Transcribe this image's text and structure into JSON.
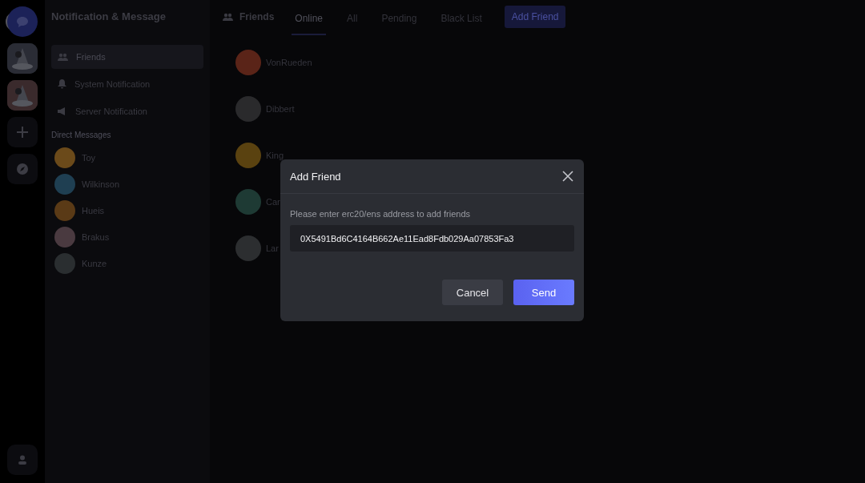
{
  "rail": {
    "items": [
      {
        "kind": "home",
        "selected": true
      },
      {
        "kind": "server",
        "color": "#2a2c35",
        "selected": false
      },
      {
        "kind": "server",
        "color": "#3a2a2c",
        "selected": false
      },
      {
        "kind": "add",
        "selected": false
      },
      {
        "kind": "explore",
        "selected": false
      }
    ]
  },
  "sidebar": {
    "title": "Notification & Message",
    "items": [
      {
        "label": "Friends",
        "selected": true
      },
      {
        "label": "System Notification",
        "selected": false
      },
      {
        "label": "Server Notification",
        "selected": false
      }
    ],
    "section_title": "Direct Messages",
    "direct_messages": [
      {
        "name": "Toy",
        "color": "#6b4a1a"
      },
      {
        "name": "Wilkinson",
        "color": "#1f3f52"
      },
      {
        "name": "Hueis",
        "color": "#5a3a16"
      },
      {
        "name": "Brakus",
        "color": "#4a3a40"
      },
      {
        "name": "Kunze",
        "color": "#2a2e30"
      }
    ]
  },
  "header": {
    "title": "Friends",
    "tabs": [
      {
        "label": "Online",
        "selected": true
      },
      {
        "label": "All",
        "selected": false
      },
      {
        "label": "Pending",
        "selected": false
      },
      {
        "label": "Black List",
        "selected": false
      }
    ],
    "add_button": "Add Friend"
  },
  "friends": [
    {
      "name": "VonRueden",
      "color": "#5a2418"
    },
    {
      "name": "Dibbert",
      "color": "#2a2a2c"
    },
    {
      "name": "King",
      "color": "#5a4210"
    },
    {
      "name": "Car",
      "color": "#1e3a34"
    },
    {
      "name": "Lar",
      "color": "#2c2e30"
    }
  ],
  "dialog": {
    "title": "Add Friend",
    "prompt": "Please enter erc20/ens address to add friends",
    "value": "0X5491Bd6C4164B662Ae11Ead8Fdb029Aa07853Fa3",
    "buttons": [
      {
        "label": "Cancel",
        "kind": "secondary"
      },
      {
        "label": "Send",
        "kind": "primary"
      }
    ]
  }
}
